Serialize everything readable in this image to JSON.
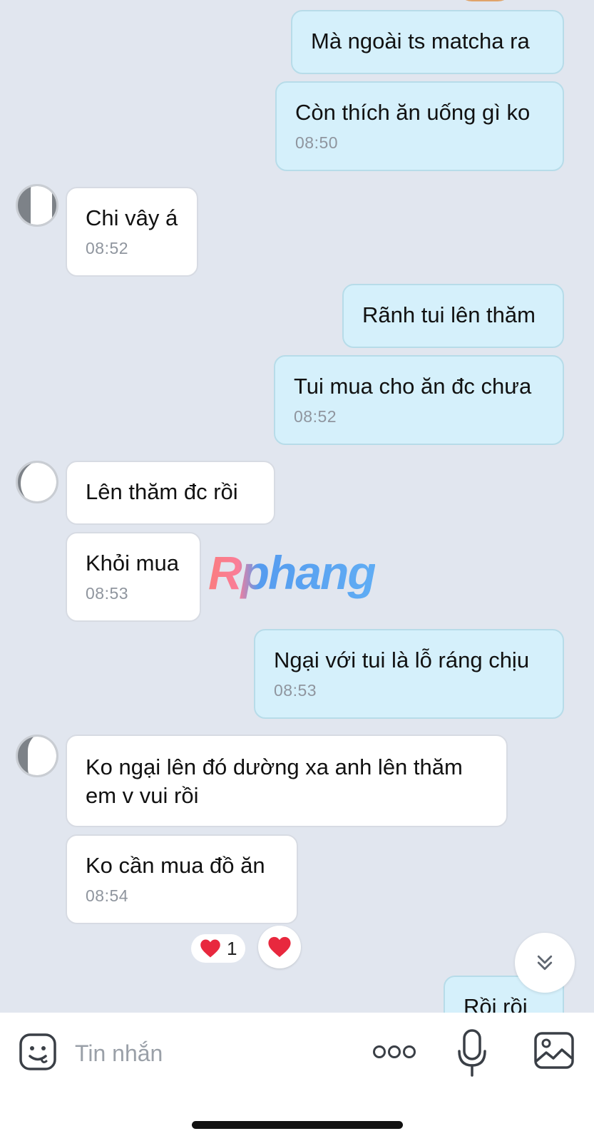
{
  "messages": [
    {
      "id": "m1",
      "text": "Mà ngoài ts matcha ra",
      "time": ""
    },
    {
      "id": "m2",
      "text": "Còn thích ăn uống gì ko",
      "time": "08:50"
    },
    {
      "id": "m3",
      "text": "Chi vây á",
      "time": "08:52"
    },
    {
      "id": "m4",
      "text": "Rãnh tui lên thăm",
      "time": ""
    },
    {
      "id": "m5",
      "text": "Tui mua cho ăn đc chưa",
      "time": "08:52"
    },
    {
      "id": "m6",
      "text": "Lên thăm đc rồi",
      "time": ""
    },
    {
      "id": "m7",
      "text": "Khỏi mua",
      "time": "08:53"
    },
    {
      "id": "m8",
      "text": "Ngại với tui là lỗ ráng chịu",
      "time": "08:53"
    },
    {
      "id": "m9",
      "text": "Ko ngại lên đó dường xa anh lên thăm em v vui rồi",
      "time": ""
    },
    {
      "id": "m10",
      "text": "Ko cần mua đồ ăn",
      "time": "08:54"
    },
    {
      "id": "m11",
      "text": "Rồi rồi",
      "time": ""
    }
  ],
  "reaction": {
    "emoji": "heart-icon",
    "count": "1"
  },
  "watermark": "Rphang",
  "composer": {
    "placeholder": "Tin nhắn"
  },
  "colors": {
    "background": "#e1e6ef",
    "outgoing": "#d5f0fb",
    "incoming": "#ffffff",
    "heart": "#e8283e"
  }
}
